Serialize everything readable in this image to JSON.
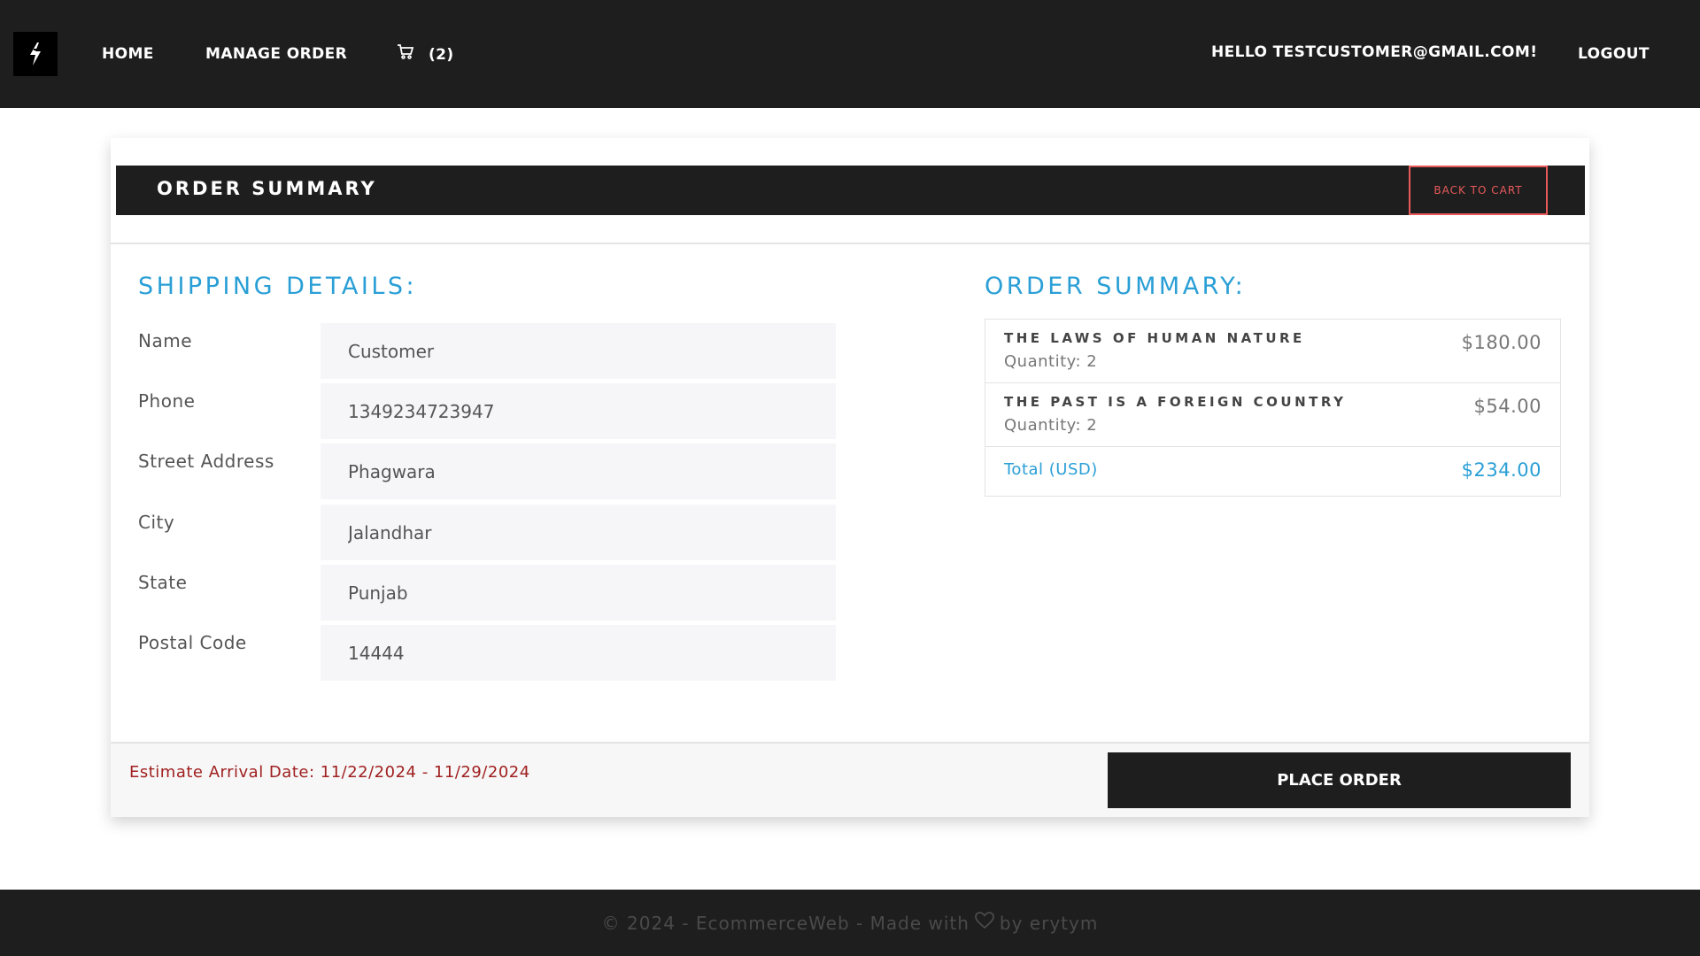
{
  "nav": {
    "home": "HOME",
    "manage_order": "MANAGE ORDER",
    "cart_count": "(2)",
    "greeting": "HELLO TESTCUSTOMER@GMAIL.COM!",
    "logout": "LOGOUT"
  },
  "header": {
    "title": "ORDER SUMMARY",
    "back_to_cart": "BACK TO CART"
  },
  "shipping": {
    "title": "SHIPPING DETAILS:",
    "fields": [
      {
        "label": "Name",
        "value": "Customer"
      },
      {
        "label": "Phone",
        "value": "1349234723947"
      },
      {
        "label": "Street Address",
        "value": "Phagwara"
      },
      {
        "label": "City",
        "value": "Jalandhar"
      },
      {
        "label": "State",
        "value": "Punjab"
      },
      {
        "label": "Postal Code",
        "value": "14444"
      }
    ]
  },
  "summary": {
    "title": "ORDER SUMMARY:",
    "items": [
      {
        "name": "THE LAWS OF HUMAN NATURE",
        "quantity": "Quantity: 2",
        "price": "$180.00"
      },
      {
        "name": "THE PAST IS A FOREIGN COUNTRY",
        "quantity": "Quantity: 2",
        "price": "$54.00"
      }
    ],
    "total_label": "Total (USD)",
    "total_value": "$234.00"
  },
  "footer_bar": {
    "arrival": "Estimate Arrival Date: 11/22/2024 - 11/29/2024",
    "place_order": "PLACE ORDER"
  },
  "page_footer": {
    "prefix": "© 2024 - EcommerceWeb - Made with",
    "suffix": "by erytym"
  },
  "colors": {
    "dark": "#1e1e1f",
    "accent_blue": "#2a9fd6",
    "back_btn_red": "#e85a5a",
    "arrival_red": "#a02020"
  },
  "icons": [
    "logo-icon",
    "cart-icon",
    "heart-icon"
  ]
}
